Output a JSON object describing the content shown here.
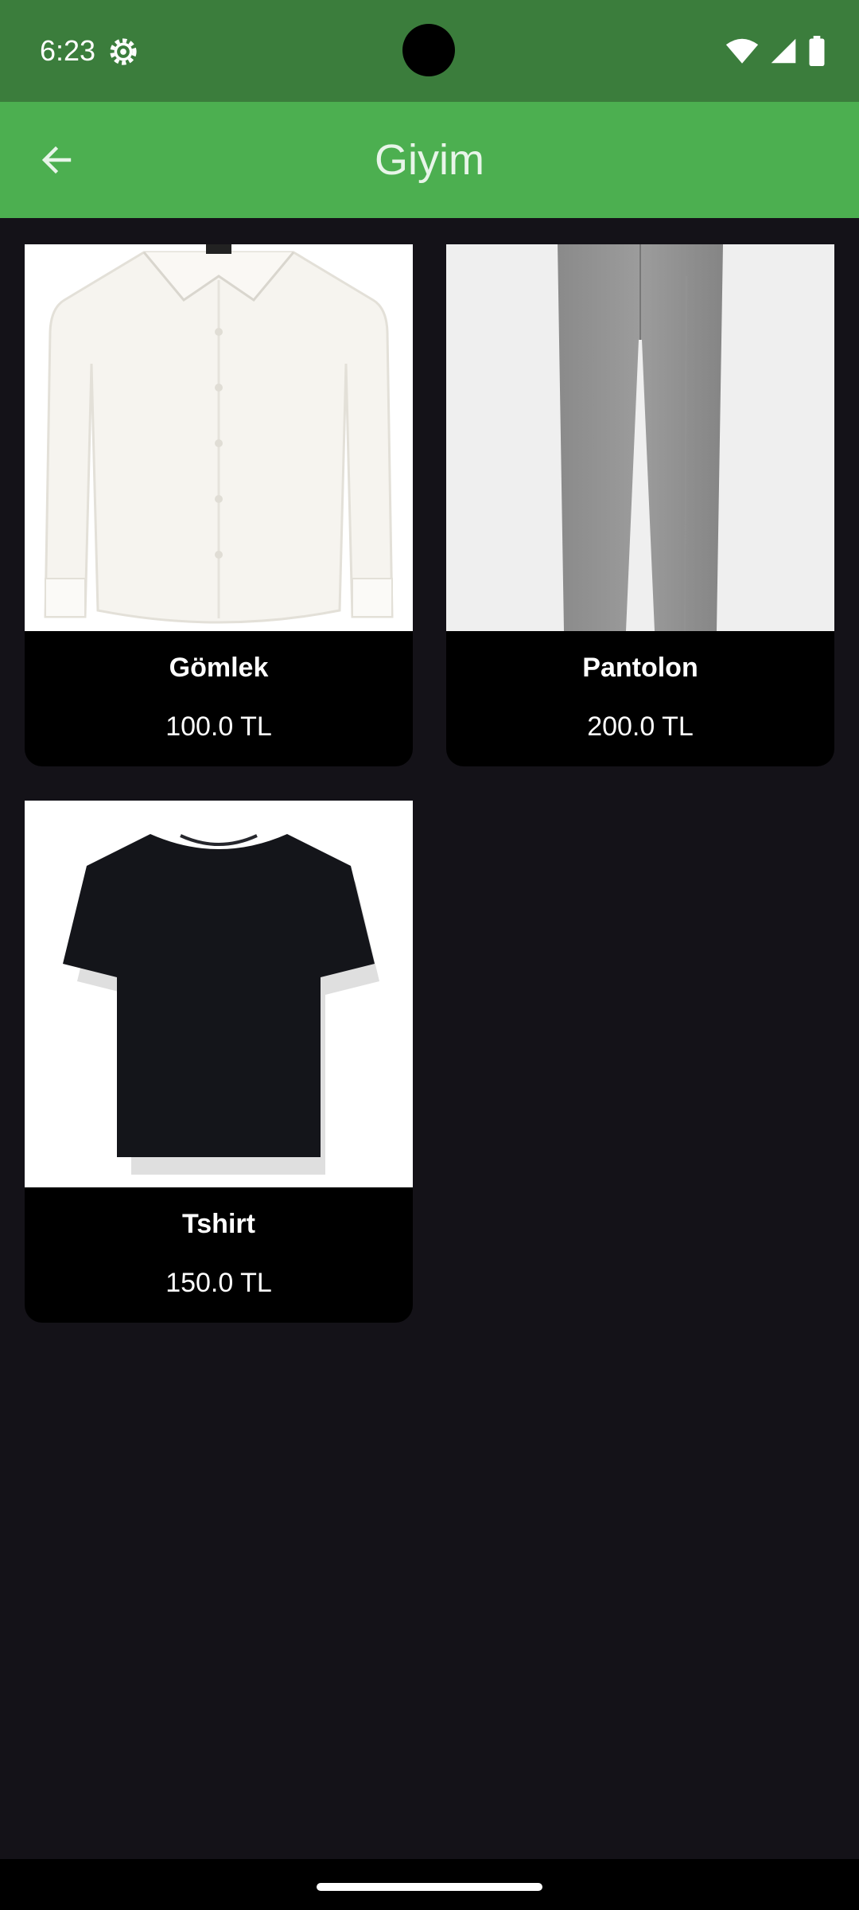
{
  "status_bar": {
    "time": "6:23"
  },
  "app_bar": {
    "title": "Giyim"
  },
  "products": [
    {
      "name": "Gömlek",
      "price": "100.0 TL",
      "image": "white-shirt"
    },
    {
      "name": "Pantolon",
      "price": "200.0 TL",
      "image": "grey-trousers"
    },
    {
      "name": "Tshirt",
      "price": "150.0 TL",
      "image": "black-tshirt"
    }
  ],
  "colors": {
    "status_bar": "#3b7d3c",
    "app_bar": "#4caf50",
    "background": "#141218",
    "card": "#000000"
  }
}
